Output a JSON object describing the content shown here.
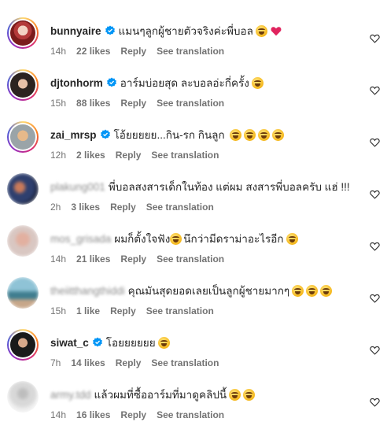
{
  "labels": {
    "reply": "Reply",
    "see_translation": "See translation"
  },
  "colors": {
    "verified_badge": "#0095f6",
    "meta_text": "#737373",
    "like_heart_emoji": "#e0245e"
  },
  "icons": {
    "verified": "verified-badge-icon",
    "like": "heart-outline-icon",
    "emoji": "laughing-face-emoji"
  },
  "comments": [
    {
      "username": "bunnyaire",
      "verified": true,
      "text": "แมนๆลูกผู้ชายตัวจริงค่ะพี่บอล",
      "emoji": [
        "star-struck-emoji",
        "red-heart-emoji"
      ],
      "time": "14h",
      "likes": "22 likes"
    },
    {
      "username": "djtonhorm",
      "verified": true,
      "text": "อาร์มบ่อยสุด ละบอลอ่ะกี่ครั้ง",
      "emoji": [
        "laughing-face-emoji"
      ],
      "time": "15h",
      "likes": "88 likes"
    },
    {
      "username": "zai_mrsp",
      "verified": true,
      "text": "โอ้ยยยยย...กิน-รก กินลูก",
      "emoji": [
        "rolling-laughing-emoji",
        "rolling-laughing-emoji",
        "rolling-laughing-emoji",
        "rolling-laughing-emoji"
      ],
      "time": "12h",
      "likes": "2 likes"
    },
    {
      "username": "plakung001",
      "verified": false,
      "text": "พี่บอลสงสารเด็กในท้อง แต่ผม สงสารพี่บอลครับ แฮ่ !!!",
      "emoji": [],
      "time": "2h",
      "likes": "3 likes"
    },
    {
      "username": "mos_grisada",
      "verified": false,
      "text": "ผมก็ตั้งใจฟัง",
      "text2": "นึกว่ามีดราม่าอะไรอีก",
      "emoji": [
        "laughing-face-emoji"
      ],
      "time": "14h",
      "likes": "21 likes"
    },
    {
      "username": "theiitthangthiddi",
      "verified": false,
      "text": "คุณมันสุดยอดเลยเป็นลูกผู้ชายมากๆ",
      "emoji": [
        "laughing-face-emoji",
        "laughing-face-emoji",
        "laughing-face-emoji"
      ],
      "time": "15h",
      "likes": "1 like"
    },
    {
      "username": "siwat_c",
      "verified": true,
      "text": "โอยยยยยย",
      "emoji": [
        "laughing-face-emoji"
      ],
      "time": "7h",
      "likes": "14 likes"
    },
    {
      "username": "army.tdd",
      "verified": false,
      "text": "แล้วผมที่ซื้ออาร์มที่มาดูคลิปนี้",
      "emoji": [
        "laughing-face-emoji",
        "laughing-face-emoji"
      ],
      "time": "14h",
      "likes": "16 likes"
    }
  ]
}
